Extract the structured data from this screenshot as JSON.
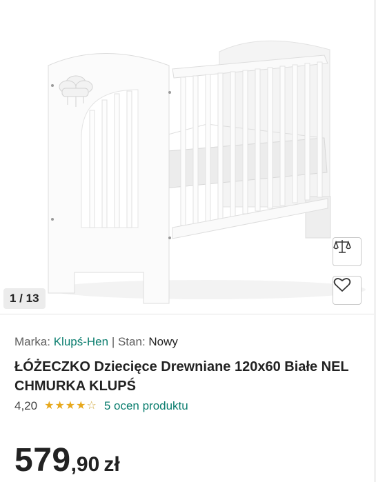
{
  "gallery": {
    "counter": "1 / 13",
    "image_alt": "white wooden baby crib with cloud decoration",
    "compare_icon": "scales-icon",
    "favorite_icon": "heart-icon"
  },
  "product": {
    "brand_label": "Marka:",
    "brand": "Klupś-Hen",
    "divider": "|",
    "condition_label": "Stan:",
    "condition": "Nowy",
    "title": "ŁÓŻECZKO Dziecięce Drewniane 120x60 Białe NEL CHMURKA KLUPŚ",
    "rating_value": "4,20",
    "rating_stars": 4.2,
    "reviews_link": "5 ocen produktu",
    "price_integer": "579",
    "price_decimal": ",90",
    "currency": "zł"
  },
  "colors": {
    "accent": "#0a7d6e",
    "star": "#e7a81c"
  }
}
